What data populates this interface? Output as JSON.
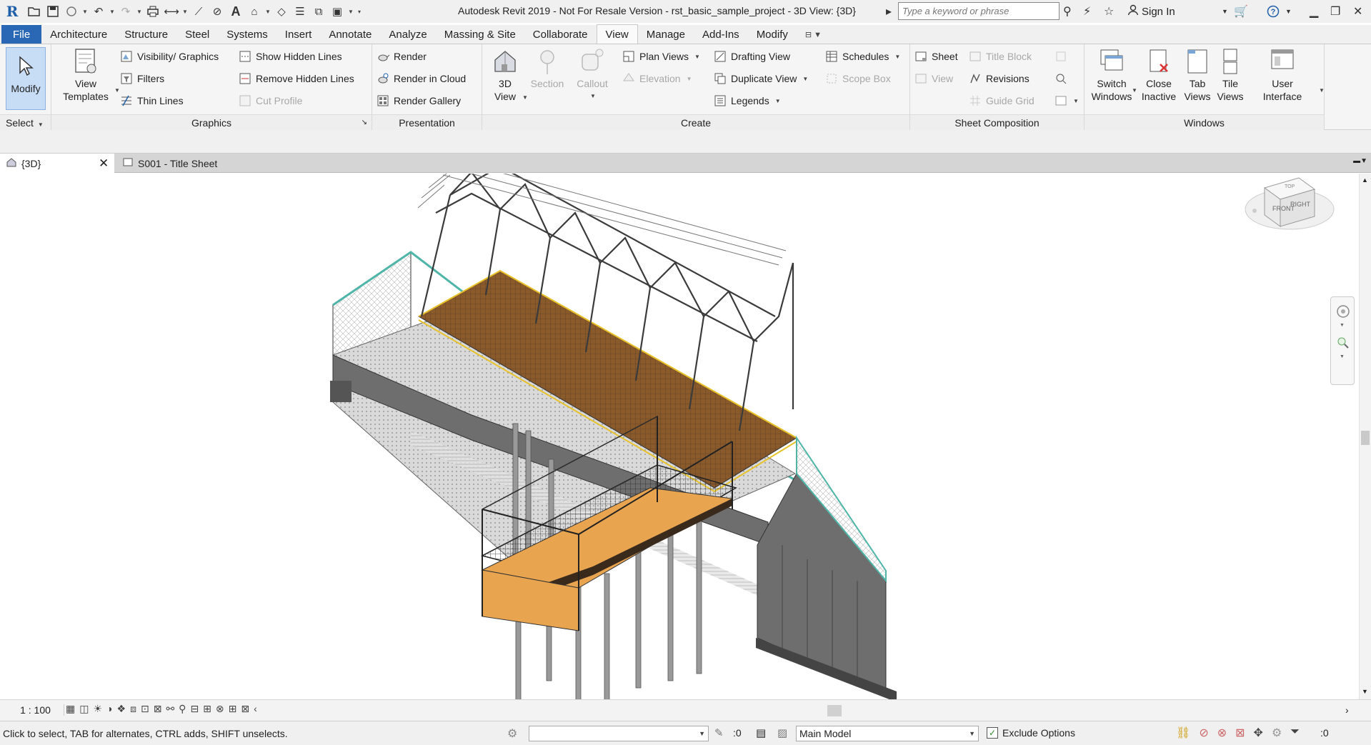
{
  "app": {
    "title": "Autodesk Revit 2019 - Not For Resale Version - rst_basic_sample_project - 3D View: {3D}",
    "search_placeholder": "Type a keyword or phrase",
    "signin_label": "Sign In",
    "logo": "R"
  },
  "tabs": [
    "File",
    "Architecture",
    "Structure",
    "Steel",
    "Systems",
    "Insert",
    "Annotate",
    "Analyze",
    "Massing & Site",
    "Collaborate",
    "View",
    "Manage",
    "Add-Ins",
    "Modify"
  ],
  "active_tab": "View",
  "ribbon": {
    "select": {
      "modify": "Modify",
      "title": "Select"
    },
    "graphics": {
      "title": "Graphics",
      "view_templates": "View Templates",
      "visibility_graphics": "Visibility/ Graphics",
      "filters": "Filters",
      "thin_lines": "Thin  Lines",
      "show_hidden_lines": "Show  Hidden Lines",
      "remove_hidden_lines": "Remove  Hidden Lines",
      "cut_profile": "Cut  Profile"
    },
    "presentation": {
      "title": "Presentation",
      "render": "Render",
      "render_in_cloud": "Render  in Cloud",
      "render_gallery": "Render  Gallery"
    },
    "create": {
      "title": "Create",
      "view_3d": "3D View",
      "section": "Section",
      "callout": "Callout",
      "plan_views": "Plan  Views",
      "elevation": "Elevation",
      "drafting_view": "Drafting  View",
      "duplicate_view": "Duplicate  View",
      "legends": "Legends",
      "schedules": "Schedules",
      "scope_box": "Scope  Box"
    },
    "sheet_composition": {
      "title": "Sheet Composition",
      "sheet": "Sheet",
      "view": "View",
      "title_block": "Title  Block",
      "revisions": "Revisions",
      "guide_grid": "Guide  Grid"
    },
    "windows": {
      "title": "Windows",
      "switch_windows": "Switch Windows",
      "close_inactive": "Close Inactive",
      "tab_views": "Tab Views",
      "tile_views": "Tile Views",
      "user_interface": "User Interface"
    }
  },
  "view_tabs": [
    {
      "label": "{3D}",
      "active": true
    },
    {
      "label": "S001 - Title Sheet",
      "active": false
    }
  ],
  "viewcube": {
    "front": "FRONT",
    "right": "RIGHT",
    "top": "TOP"
  },
  "view_control": {
    "scale": "1 : 100"
  },
  "status": {
    "message": "Click to select, TAB for alternates, CTRL adds, SHIFT unselects.",
    "selection_count": ":0",
    "model": "Main Model",
    "exclude_options": "Exclude Options",
    "filter_count": ":0"
  }
}
